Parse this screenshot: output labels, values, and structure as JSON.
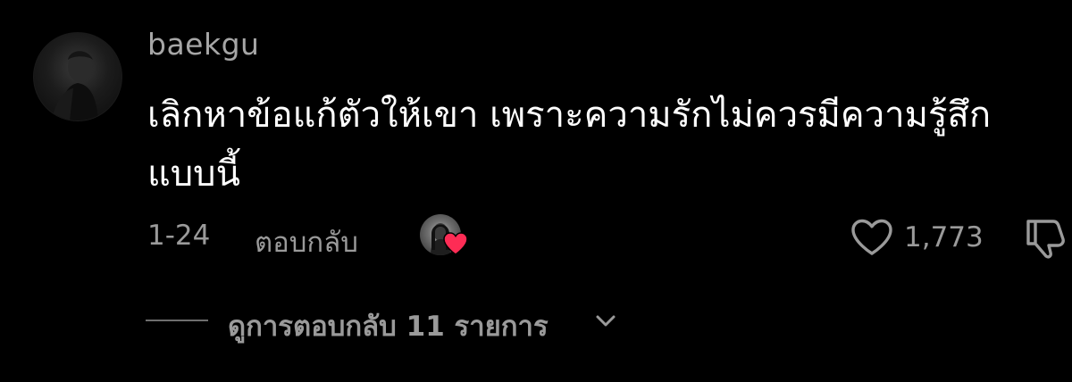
{
  "comment": {
    "username": "baekgu",
    "text": "เลิกหาข้อแก้ตัวให้เขา เพราะความรักไม่ควรมีความรู้สึกแบบนี้",
    "timestamp": "1-24",
    "reply_label": "ตอบกลับ",
    "like_count": "1,773",
    "creator_liked": true,
    "view_replies_label": "ดูการตอบกลับ 11 รายการ"
  },
  "icons": {
    "like": "heart-outline-icon",
    "dislike": "thumbs-down-icon",
    "creator_heart": "heart-filled-icon",
    "expand": "chevron-down-icon"
  },
  "colors": {
    "background": "#000000",
    "primary_text": "#ffffff",
    "secondary_text": "#9a9a9a",
    "heart_accent": "#fe2c55"
  }
}
